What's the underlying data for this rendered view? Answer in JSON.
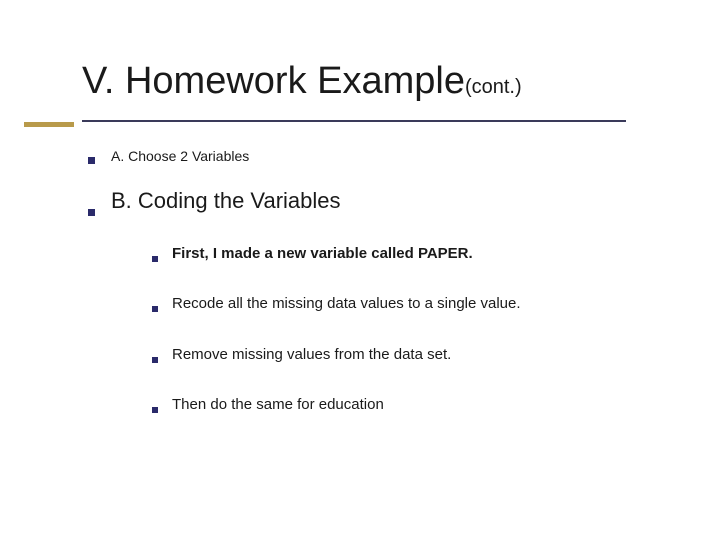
{
  "title": "V. Homework Example",
  "title_suffix": "(cont.)",
  "level1": [
    {
      "text": "A. Choose 2 Variables",
      "style": "small"
    },
    {
      "text": "B. Coding the Variables",
      "style": "large"
    }
  ],
  "level2": [
    {
      "text": "First, I made a new variable called PAPER.",
      "bold": true
    },
    {
      "text": "Recode all the missing data values to a single value.",
      "bold": false
    },
    {
      "text": "Remove missing values from the data set.",
      "bold": false
    },
    {
      "text": "Then do the same for education",
      "bold": false
    }
  ]
}
